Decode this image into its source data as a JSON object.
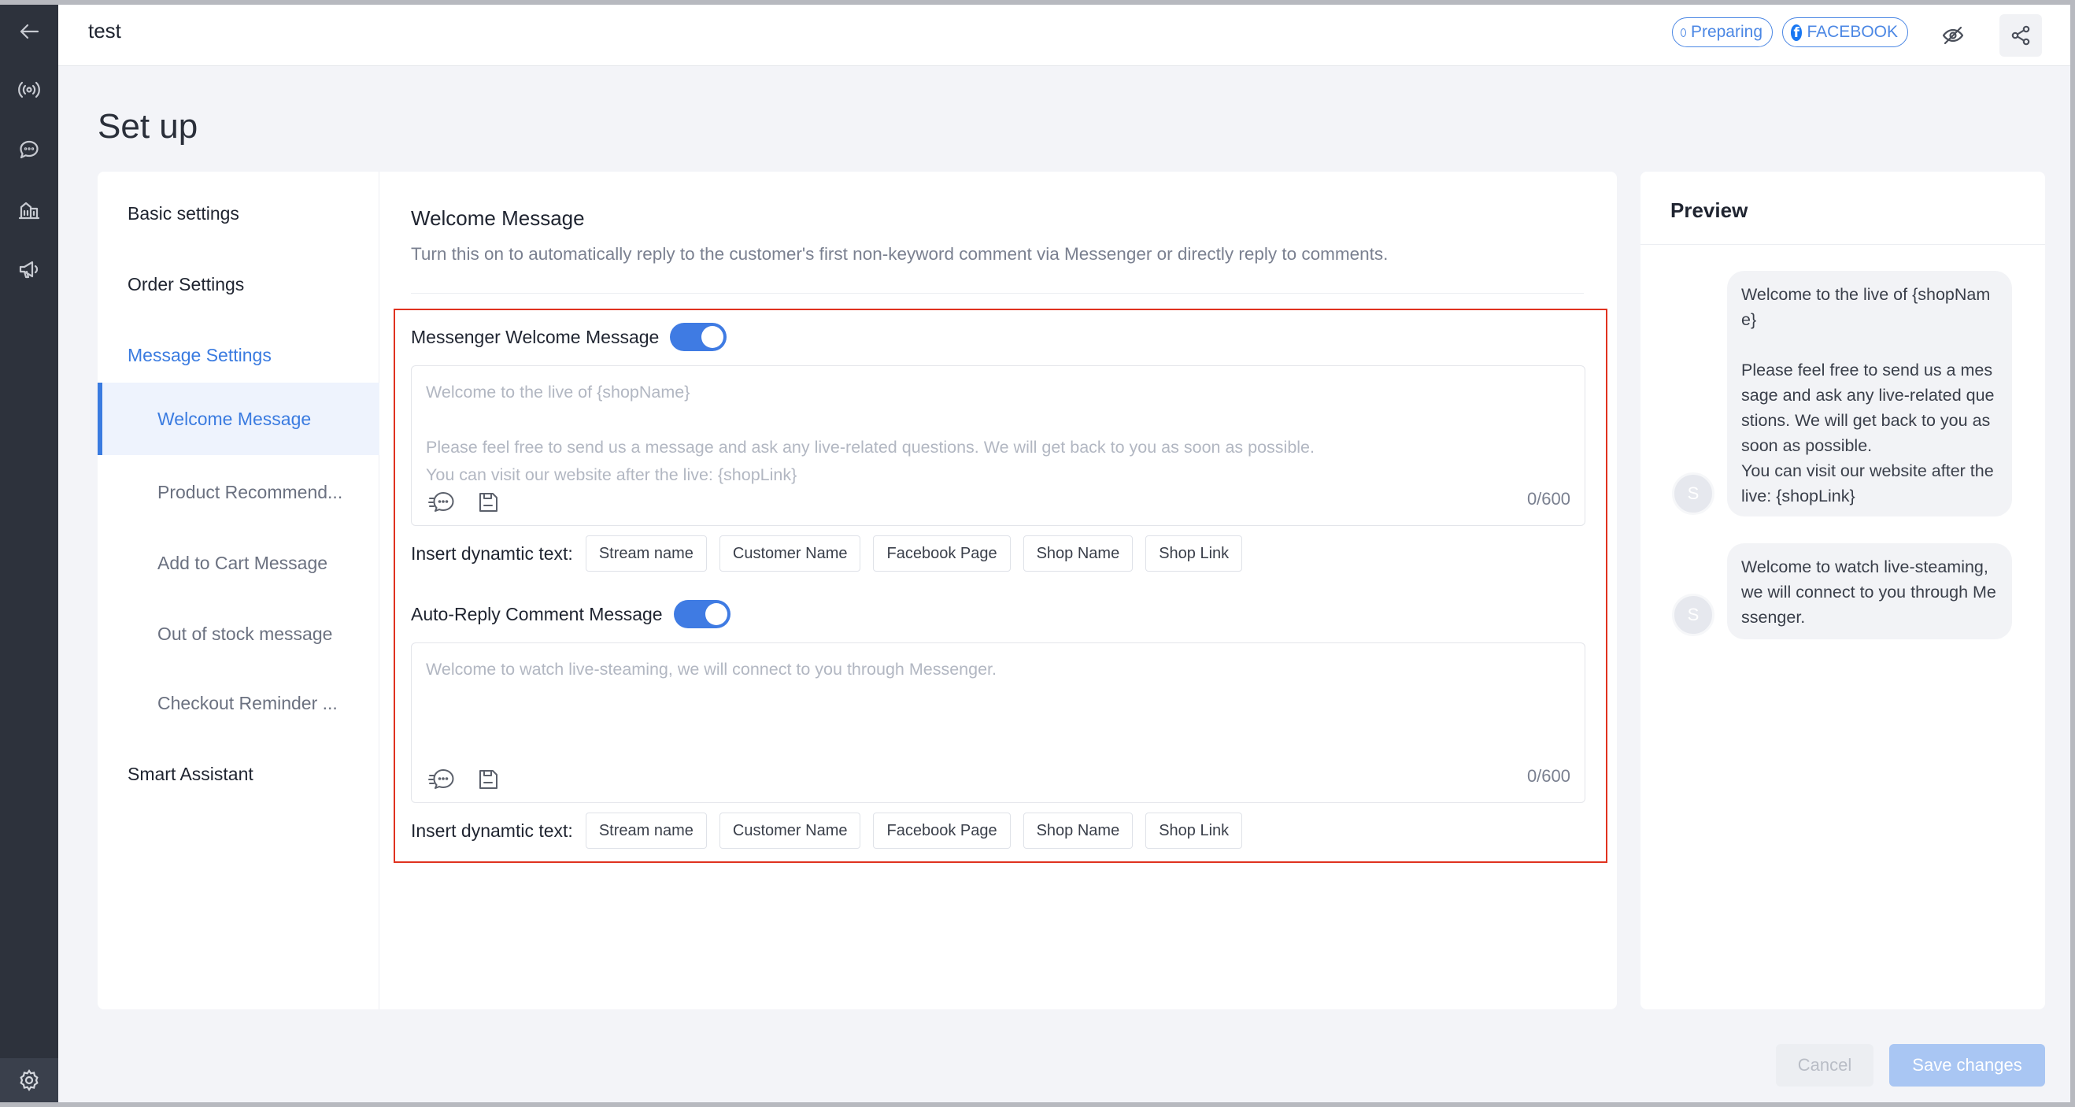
{
  "header": {
    "title": "test",
    "status_tag": "Preparing",
    "platform_tag": "FACEBOOK",
    "fb_glyph": "f"
  },
  "rail": {
    "icons": [
      "back-arrow-icon",
      "broadcast-icon",
      "chat-icon",
      "analytics-icon",
      "megaphone-icon",
      "gear-icon"
    ]
  },
  "page": {
    "title": "Set up"
  },
  "subnav": {
    "items": [
      {
        "label": "Basic settings"
      },
      {
        "label": "Order Settings"
      },
      {
        "label": "Message Settings"
      },
      {
        "label": "Welcome Message"
      },
      {
        "label": "Product Recommend..."
      },
      {
        "label": "Add to Cart Message"
      },
      {
        "label": "Out of stock message"
      },
      {
        "label": "Checkout Reminder ..."
      },
      {
        "label": "Smart Assistant"
      }
    ]
  },
  "section": {
    "title": "Welcome Message",
    "description": "Turn this on to automatically reply to the customer's first non-keyword comment via Messenger or directly reply to comments."
  },
  "messenger": {
    "label": "Messenger Welcome Message",
    "enabled": true,
    "placeholder": "Welcome to the live of {shopName}\n\nPlease feel free to send us a message and ask any live-related questions. We will get back to you as soon as possible.\nYou can visit our website after the live: {shopLink}",
    "count": "0/600",
    "insert_label": "Insert dynamtic text:",
    "chips": [
      "Stream name",
      "Customer Name",
      "Facebook Page",
      "Shop Name",
      "Shop Link"
    ]
  },
  "comment": {
    "label": "Auto-Reply Comment Message",
    "enabled": true,
    "placeholder": "Welcome to watch live-steaming, we will connect to you through Messenger.",
    "count": "0/600",
    "insert_label": "Insert dynamtic text:",
    "chips": [
      "Stream name",
      "Customer Name",
      "Facebook Page",
      "Shop Name",
      "Shop Link"
    ]
  },
  "preview": {
    "title": "Preview",
    "bubble1": "Welcome to the live of {shopName}\n\nPlease feel free to send us a message and ask any live-related questions. We will get back to you as soon as possible.\nYou can visit our website after the live: {shopLink}",
    "bubble2": "Welcome to watch live-steaming, we will connect to you through Messenger.",
    "avatar_letter": "S"
  },
  "footer": {
    "cancel_label": "Cancel",
    "save_label": "Save changes"
  },
  "colors": {
    "accent": "#3f7be3",
    "highlight_border": "#e0321f",
    "rail_bg": "#2d323c"
  }
}
